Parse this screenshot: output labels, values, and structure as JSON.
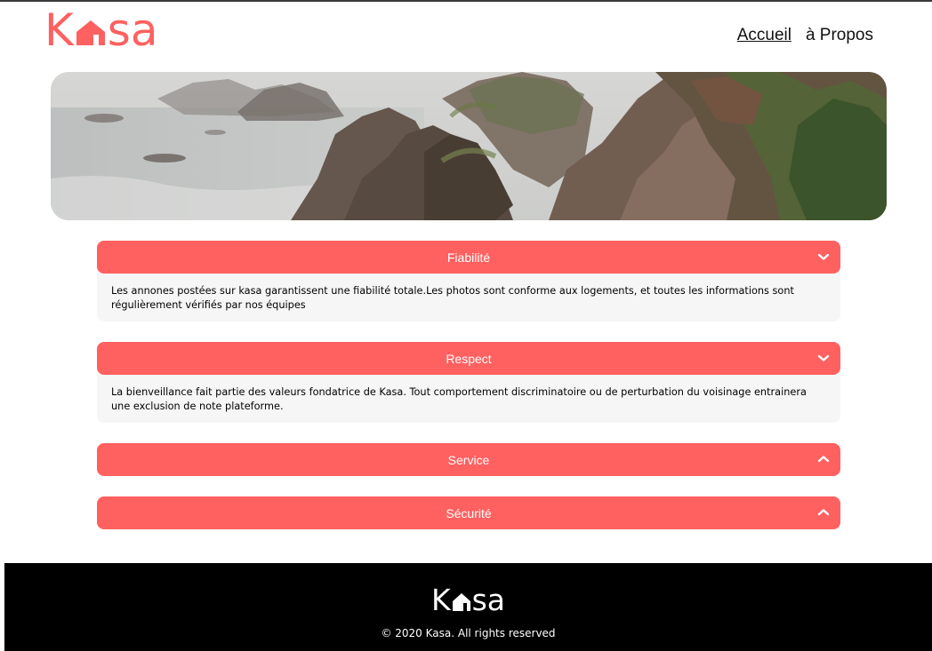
{
  "brand": {
    "logo_first": "K",
    "logo_rest": "sa",
    "color": "#ff6060"
  },
  "nav": {
    "items": [
      {
        "label": "Accueil",
        "active": true
      },
      {
        "label": "à Propos",
        "active": false
      }
    ]
  },
  "banner": {
    "icon": "coastal-cliffs-image"
  },
  "sections": [
    {
      "title": "Fiabilité",
      "expanded": true,
      "chevron": "chevron-down-icon",
      "text": "Les annones postées sur kasa garantissent une fiabilité totale.Les photos sont conforme aux logements, et toutes les informations sont régulièrement vérifiés par nos équipes"
    },
    {
      "title": "Respect",
      "expanded": true,
      "chevron": "chevron-down-icon",
      "text": "La bienveillance fait partie des valeurs fondatrice de Kasa. Tout comportement discriminatoire ou de perturbation du voisinage entrainera une exclusion de note plateforme."
    },
    {
      "title": "Service",
      "expanded": false,
      "chevron": "chevron-up-icon"
    },
    {
      "title": "Sécurité",
      "expanded": false,
      "chevron": "chevron-up-icon"
    }
  ],
  "footer": {
    "logo_first": "K",
    "logo_rest": "sa",
    "copyright": "© 2020 Kasa. All rights reserved"
  }
}
